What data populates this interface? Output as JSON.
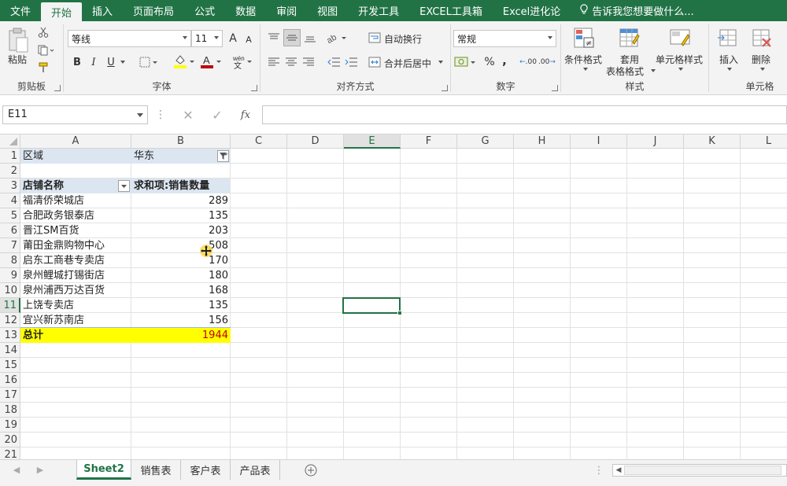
{
  "menu": {
    "items": [
      "文件",
      "开始",
      "插入",
      "页面布局",
      "公式",
      "数据",
      "审阅",
      "视图",
      "开发工具",
      "EXCEL工具箱",
      "Excel进化论"
    ],
    "tell_me": "告诉我您想要做什么..."
  },
  "ribbon": {
    "clipboard": {
      "label": "剪贴板",
      "paste": "粘贴"
    },
    "font": {
      "label": "字体",
      "name": "等线",
      "size": "11",
      "bold": "B",
      "italic": "I",
      "underline": "U",
      "grow": "A",
      "shrink": "A"
    },
    "align": {
      "label": "对齐方式",
      "wrap": "自动换行",
      "merge": "合并后居中"
    },
    "number": {
      "label": "数字",
      "format": "常规",
      "percent": "%",
      "comma": ",",
      "inc": ".00",
      "dec": ".00"
    },
    "styles": {
      "label": "样式",
      "conditional": "条件格式",
      "table_fmt_line1": "套用",
      "table_fmt_line2": "表格格式",
      "cell_styles": "单元格样式"
    },
    "cells": {
      "label": "单元格",
      "insert": "插入",
      "delete": "删除"
    }
  },
  "formula_bar": {
    "name_box": "E11",
    "cancel": "✕",
    "confirm": "✓",
    "fx": "fx",
    "formula": ""
  },
  "grid": {
    "columns": [
      "A",
      "B",
      "C",
      "D",
      "E",
      "F",
      "G",
      "H",
      "I",
      "J",
      "K",
      "L"
    ],
    "rows": [
      "1",
      "2",
      "3",
      "4",
      "5",
      "6",
      "7",
      "8",
      "9",
      "10",
      "11",
      "12",
      "13",
      "14",
      "15",
      "16",
      "17",
      "18",
      "19",
      "20",
      "21"
    ],
    "selected_cell": "E11",
    "filter": {
      "label": "区域",
      "value": "华东"
    },
    "pivot_header": {
      "row_label": "店铺名称",
      "value_label": "求和项:销售数量"
    },
    "pivot_rows": [
      {
        "store": "福清侨荣城店",
        "qty": "289"
      },
      {
        "store": "合肥政务银泰店",
        "qty": "135"
      },
      {
        "store": "晋江SM百货",
        "qty": "203"
      },
      {
        "store": "莆田金鼎购物中心",
        "qty": "508"
      },
      {
        "store": "启东工商巷专卖店",
        "qty": "170"
      },
      {
        "store": "泉州鲤城打锡街店",
        "qty": "180"
      },
      {
        "store": "泉州浦西万达百货",
        "qty": "168"
      },
      {
        "store": "上饶专卖店",
        "qty": "135"
      },
      {
        "store": "宜兴新苏南店",
        "qty": "156"
      }
    ],
    "total": {
      "label": "总计",
      "value": "1944"
    }
  },
  "sheets": {
    "tabs": [
      "Sheet2",
      "销售表",
      "客户表",
      "产品表"
    ],
    "active": "Sheet2"
  },
  "colors": {
    "accent": "#217346",
    "total_text": "#c00000",
    "total_fill": "#ffff00",
    "header_fill": "#dce6f1"
  }
}
